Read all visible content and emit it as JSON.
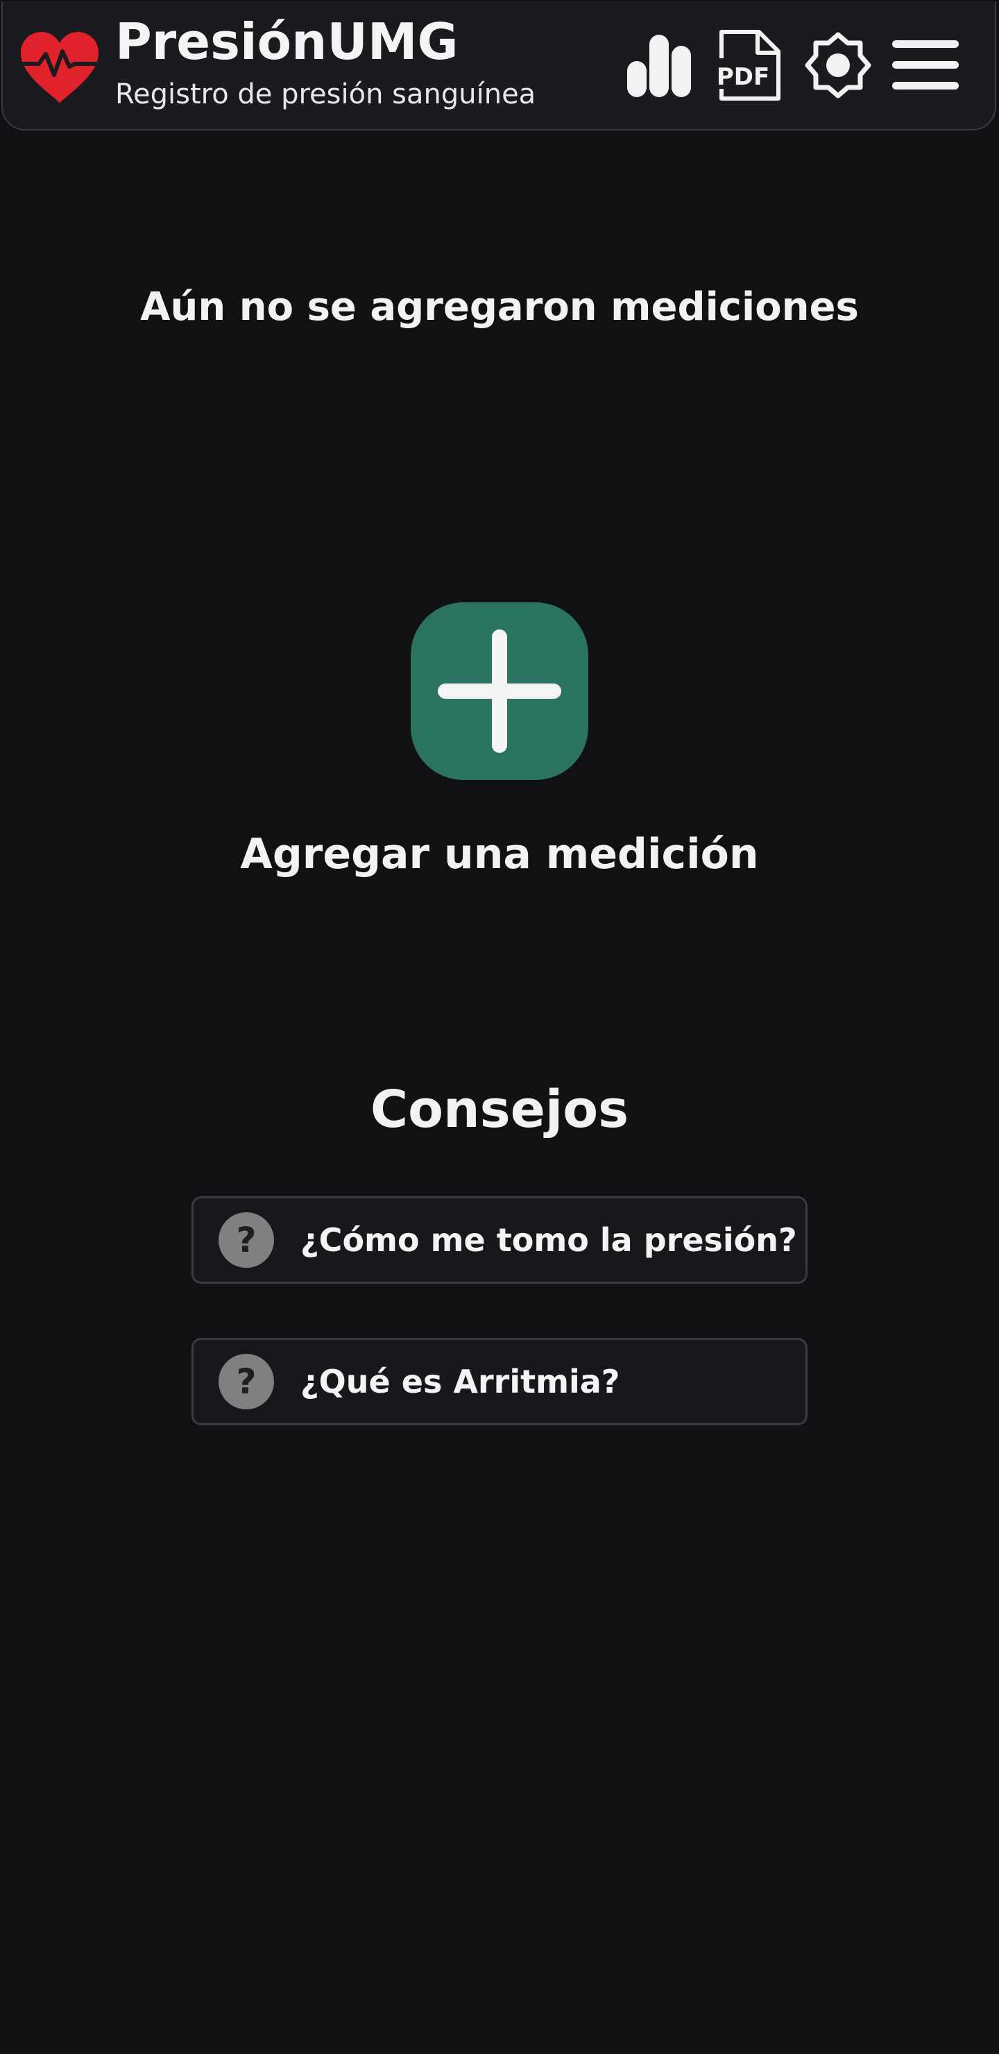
{
  "header": {
    "title": "PresiónUMG",
    "subtitle": "Registro de presión sanguínea",
    "logo_icon": "heart-pulse-icon",
    "actions": [
      {
        "name": "stats",
        "icon": "bar-chart-icon"
      },
      {
        "name": "pdf",
        "icon": "pdf-file-icon",
        "label": "PDF"
      },
      {
        "name": "theme",
        "icon": "brightness-icon"
      },
      {
        "name": "menu",
        "icon": "hamburger-menu-icon"
      }
    ]
  },
  "empty_state": {
    "message": "Aún no se agregaron mediciones",
    "add_icon": "plus-icon",
    "add_label": "Agregar una medición"
  },
  "tips": {
    "title": "Consejos",
    "items": [
      {
        "icon": "help-circle-icon",
        "glyph": "?",
        "label": "¿Cómo me tomo la presión?"
      },
      {
        "icon": "help-circle-icon",
        "glyph": "?",
        "label": "¿Qué es Arritmia?"
      }
    ]
  },
  "colors": {
    "background": "#111113",
    "header_background": "#1a1a1f",
    "brand_red": "#e0222a",
    "accent_green": "#2b7361",
    "tip_icon": "#808080"
  }
}
